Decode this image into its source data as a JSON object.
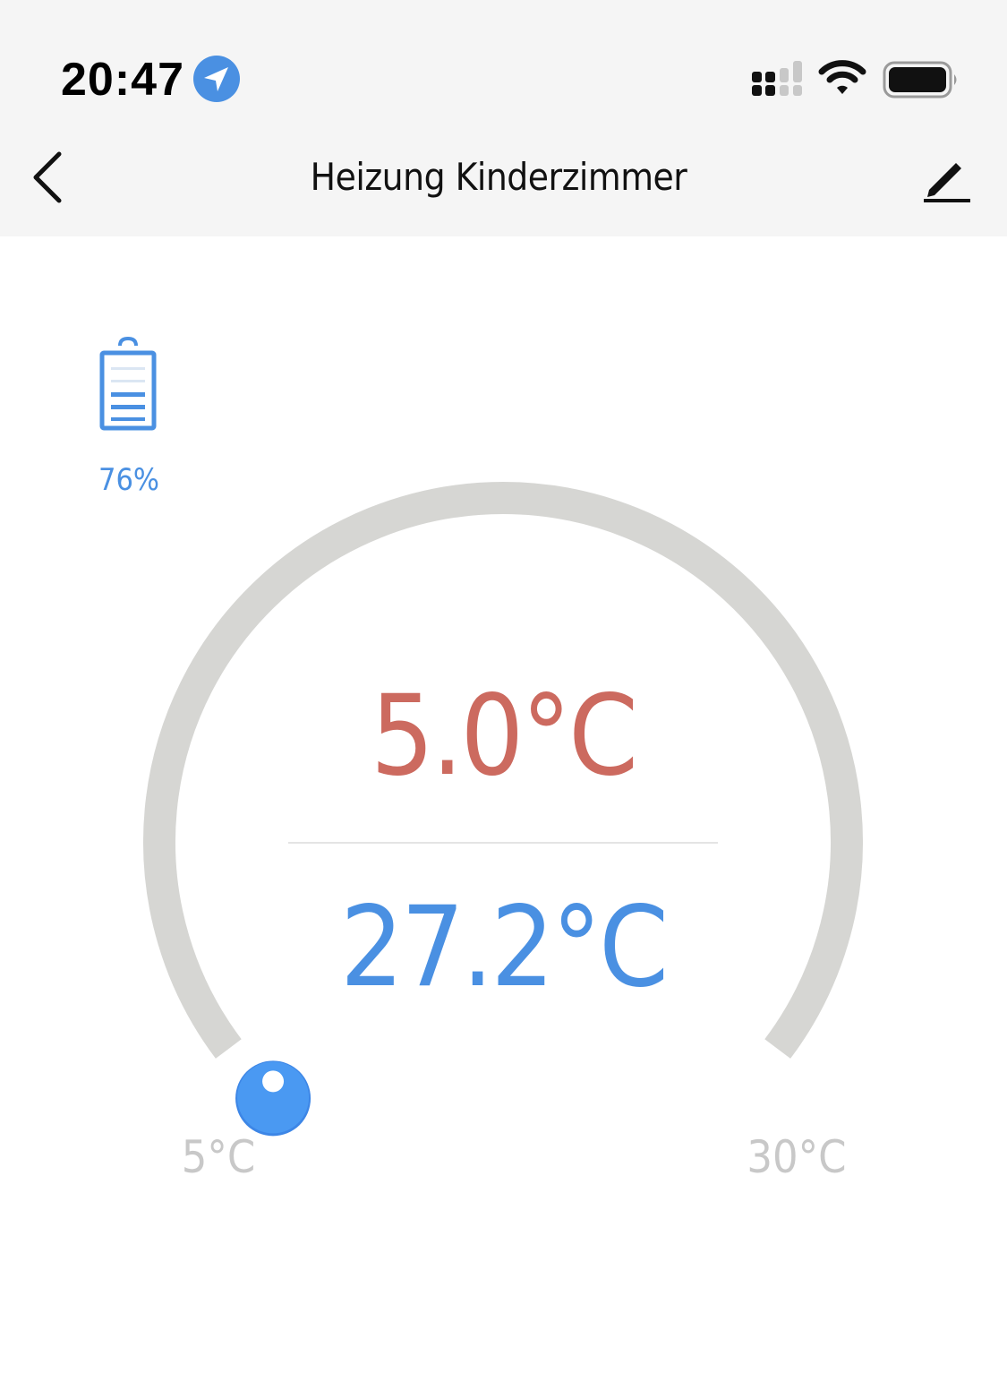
{
  "status_bar": {
    "time": "20:47",
    "location_icon": "location-arrow-icon",
    "signal_icon": "cellular-signal-icon",
    "wifi_icon": "wifi-icon",
    "battery_icon": "battery-full-icon"
  },
  "nav": {
    "title": "Heizung Kinderzimmer",
    "back_icon": "chevron-left-icon",
    "edit_icon": "pencil-icon"
  },
  "device": {
    "battery_level": "76%",
    "battery_icon": "device-battery-icon"
  },
  "thermostat": {
    "set_temperature": "5.0°C",
    "current_temperature": "27.2°C",
    "range_min_label": "5°C",
    "range_max_label": "30°C",
    "slider_value_fraction": 0
  },
  "colors": {
    "accent": "#4a90e2",
    "set_temperature": "#cc6a5f",
    "track": "#d6d6d3",
    "header_background": "#f5f5f5",
    "range_label": "#c8c8c8"
  }
}
